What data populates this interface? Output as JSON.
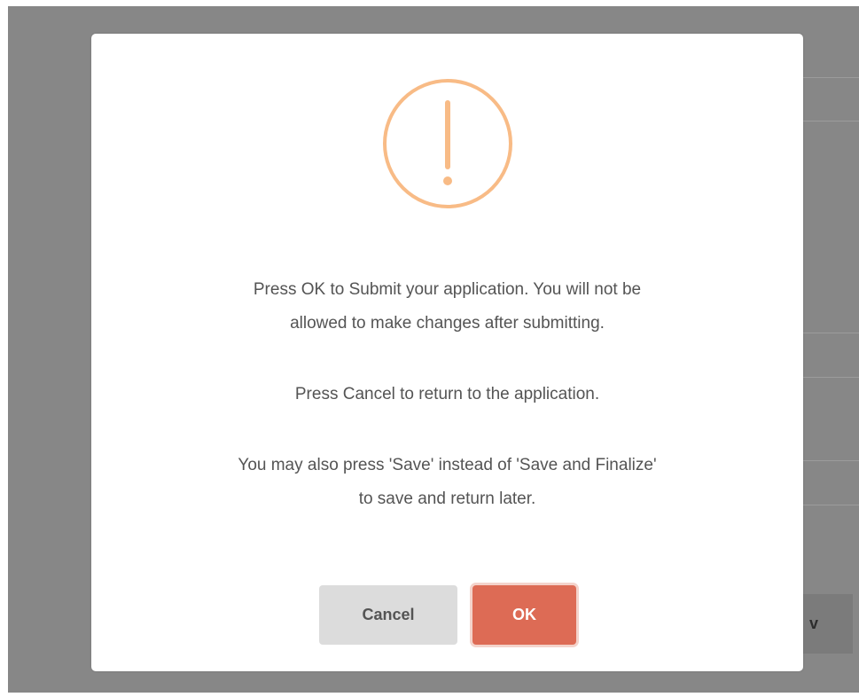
{
  "dialog": {
    "icon": "warning-exclamation-icon",
    "icon_color": "#f8bb86",
    "message_line1a": "Press OK to Submit your application. You will not be",
    "message_line1b": "allowed to make changes after submitting.",
    "message_line2": "Press Cancel to return to the application.",
    "message_line3a": "You may also press 'Save' instead of 'Save and Finalize'",
    "message_line3b": "to save and return later.",
    "cancel_label": "Cancel",
    "ok_label": "OK",
    "ok_color": "#dd6b55",
    "cancel_color": "#dcdcdc"
  },
  "background": {
    "partial_button_label": "v"
  }
}
